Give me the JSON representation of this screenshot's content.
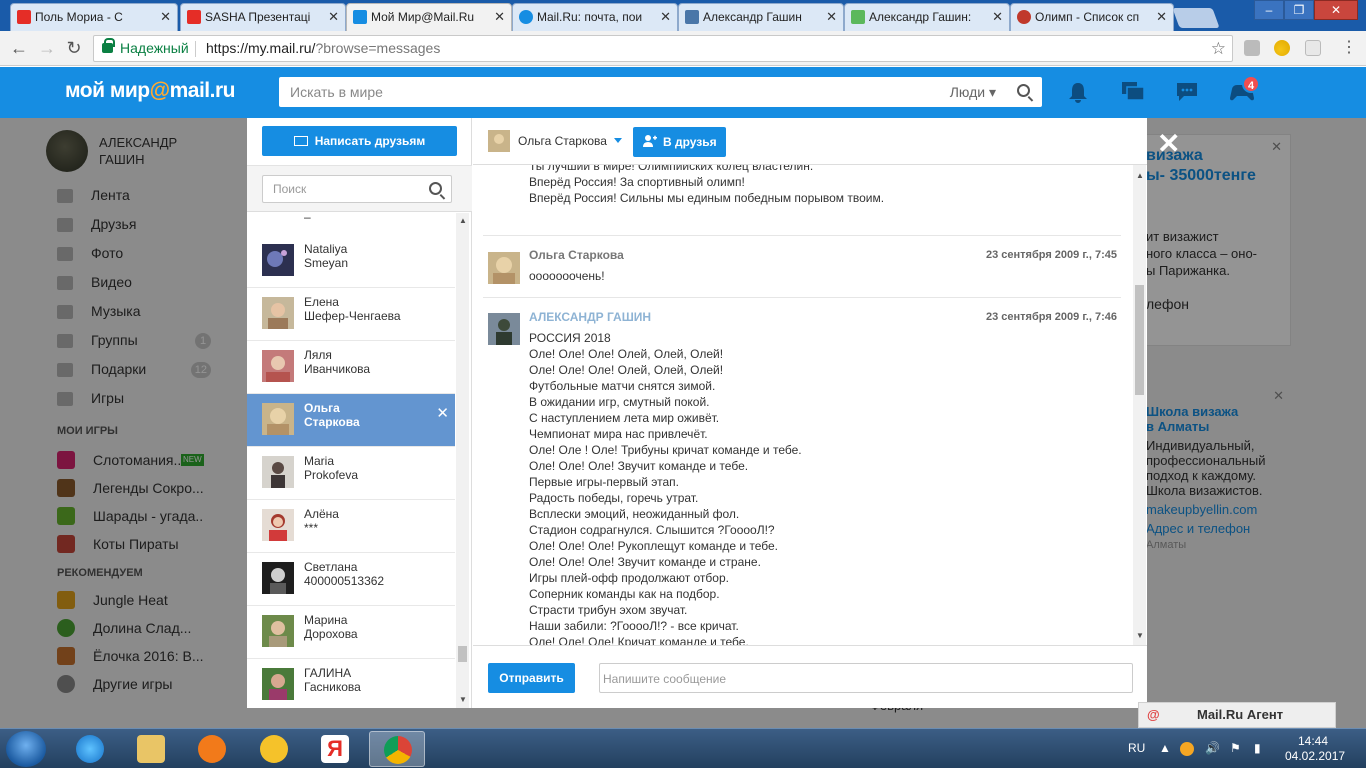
{
  "browser": {
    "tabs": [
      {
        "title": "Поль Мориа - С",
        "icon_color": "#e52d27"
      },
      {
        "title": "SASHA Презентаці",
        "icon_color": "#e52d27"
      },
      {
        "title": "Мой Мир@Mail.Ru",
        "icon_color": "#168de2"
      },
      {
        "title": "Mail.Ru: почта, пои",
        "icon_color": "#168de2"
      },
      {
        "title": "Александр Гашин",
        "icon_color": "#4a76a8"
      },
      {
        "title": "Александр Гашин:",
        "icon_color": "#5cb85c"
      },
      {
        "title": "Олимп - Список сп",
        "icon_color": "#c0392b"
      }
    ],
    "secure_label": "Надежный",
    "url_main": "https://my.mail.ru/",
    "url_rest": "?browse=messages"
  },
  "header": {
    "logo_left": "мой мир",
    "logo_at": "@",
    "logo_right": "mail.ru",
    "search_placeholder": "Искать в мире",
    "search_scope": "Люди",
    "games_badge": "4"
  },
  "sidebar": {
    "user_name": "АЛЕКСАНДР ГАШИН",
    "nav": [
      {
        "label": "Лента",
        "count": ""
      },
      {
        "label": "Друзья",
        "count": ""
      },
      {
        "label": "Фото",
        "count": ""
      },
      {
        "label": "Видео",
        "count": ""
      },
      {
        "label": "Музыка",
        "count": ""
      },
      {
        "label": "Группы",
        "count": "1"
      },
      {
        "label": "Подарки",
        "count": "12"
      },
      {
        "label": "Игры",
        "count": ""
      }
    ],
    "my_games_title": "МОИ ИГРЫ",
    "my_games": [
      {
        "label": "Слотомания...",
        "badge": "NEW"
      },
      {
        "label": "Легенды Сокро...",
        "badge": ""
      },
      {
        "label": "Шарады - угада...",
        "badge": ""
      },
      {
        "label": "Коты Пираты",
        "badge": ""
      }
    ],
    "recommend_title": "РЕКОМЕНДУЕМ",
    "recommend": [
      {
        "label": "Jungle Heat"
      },
      {
        "label": "Долина Слад..."
      },
      {
        "label": "Ёлочка 2016: В..."
      },
      {
        "label": "Другие игры"
      }
    ]
  },
  "ads": {
    "ad1_title_1": "визажа",
    "ad1_title_2": "ы- 35000тенге",
    "ad1_text_1": "ит визажист",
    "ad1_text_2": "ного класса – оно-",
    "ad1_text_3": "ы Парижанка.",
    "ad1_link": "лефон",
    "ad2_title_1": "Школа визажа",
    "ad2_title_2": "в Алматы",
    "ad2_text_1": "Индивидуальный,",
    "ad2_text_2": "профессиональный",
    "ad2_text_3": "подход к каждому.",
    "ad2_text_4": "Школа визажистов.",
    "ad2_link_1": "makeupbyellin.com",
    "ad2_link_2": "Адрес и телефон",
    "ad2_city": "Алматы",
    "bottom_text": "Февраля"
  },
  "dialog": {
    "write_button": "Написать друзьям",
    "search_placeholder": "Поиск",
    "contacts_top_stub": "–",
    "contacts": [
      {
        "first": "Nataliya",
        "last": "Smeyan",
        "selected": false
      },
      {
        "first": "Елена",
        "last": "Шефер-Ченгаева",
        "selected": false
      },
      {
        "first": "Ляля",
        "last": "Иванчикова",
        "selected": false
      },
      {
        "first": "Ольга",
        "last": "Старкова",
        "selected": true
      },
      {
        "first": "Maria",
        "last": "Prokofeva",
        "selected": false
      },
      {
        "first": "Алёна",
        "last": "***",
        "selected": false
      },
      {
        "first": "Светлана",
        "last": "400000513362",
        "selected": false
      },
      {
        "first": "Марина",
        "last": "Дорохова",
        "selected": false
      },
      {
        "first": "ГАЛИНА",
        "last": "Гасникова",
        "selected": false
      }
    ],
    "chat_name": "Ольга Старкова",
    "add_friend": "В друзья",
    "prev_lines": [
      "Ты лучший в мире! Олимпийских колец властелин.",
      "Вперёд Россия! За спортивный олимп!",
      "Вперёд Россия! Сильны мы единым победным порывом твоим."
    ],
    "msg1": {
      "sender": "Ольга Старкова",
      "date": "23 сентября 2009 г., 7:45",
      "text": "ооооооочень!"
    },
    "msg2": {
      "sender": "АЛЕКСАНДР ГАШИН",
      "date": "23 сентября 2009 г., 7:46",
      "lines": [
        "РОССИЯ 2018",
        "Оле! Оле! Оле! Олей, Олей, Олей!",
        "Оле! Оле! Оле! Олей, Олей, Олей!",
        "Футбольные матчи снятся зимой.",
        "В ожидании игр, смутный покой.",
        "С наступлением лета мир оживёт.",
        "Чемпионат мира нас привлечёт.",
        "Оле! Оле ! Оле! Трибуны кричат команде и тебе.",
        "Оле! Оле! Оле! Звучит команде и тебе.",
        "Первые игры-первый этап.",
        "Радость победы, горечь утрат.",
        "Всплески эмоций, неожиданный фол.",
        "Стадион содрагнулся. Слышится ?ГооооЛ!?",
        "Оле! Оле! Оле! Рукоплещут команде и тебе.",
        "Оле! Оле! Оле! Звучит команде и стране.",
        "Игры плей-офф продолжают отбор.",
        "Соперник команды как на подбор.",
        "Страсти трибун эхом звучат.",
        "Наши забили: ?ГооооЛ!? - все кричат.",
        "Оле! Оле! Оле! Кричат команде и тебе."
      ]
    },
    "send_button": "Отправить",
    "input_placeholder": "Напишите сообщение"
  },
  "agent": {
    "label": "Mail.Ru Агент"
  },
  "taskbar": {
    "lang": "RU",
    "time": "14:44",
    "date": "04.02.2017"
  }
}
